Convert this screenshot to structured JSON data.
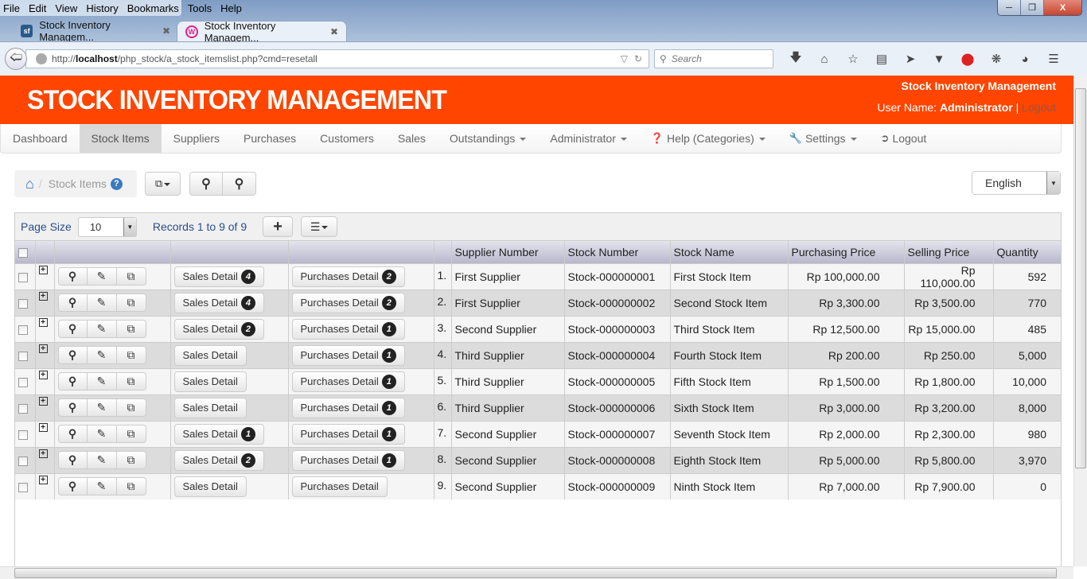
{
  "browser": {
    "menu": [
      "File",
      "Edit",
      "View",
      "History",
      "Bookmarks",
      "Tools",
      "Help"
    ],
    "tabs": [
      {
        "title": "Stock Inventory Managem...",
        "favicon": "sf",
        "active": false
      },
      {
        "title": "Stock Inventory Managem...",
        "favicon": "W",
        "active": true
      }
    ],
    "url_prefix": "http://",
    "url_host": "localhost",
    "url_path": "/php_stock/a_stock_itemslist.php?cmd=resetall",
    "search_placeholder": "Search"
  },
  "header": {
    "logo": "STOCK INVENTORY MANAGEMENT",
    "app_name": "Stock Inventory Management",
    "user_label": "User Name:",
    "user_name": "Administrator",
    "separator": "|",
    "logout": "Logout",
    "accent": "#ff4500"
  },
  "nav": [
    {
      "label": "Dashboard",
      "active": false
    },
    {
      "label": "Stock Items",
      "active": true
    },
    {
      "label": "Suppliers"
    },
    {
      "label": "Purchases"
    },
    {
      "label": "Customers"
    },
    {
      "label": "Sales"
    },
    {
      "label": "Outstandings",
      "dropdown": true
    },
    {
      "label": "Administrator",
      "dropdown": true
    },
    {
      "label": "Help (Categories)",
      "dropdown": true,
      "icon": "question-circle-icon"
    },
    {
      "label": "Settings",
      "dropdown": true,
      "icon": "wrench-icon"
    },
    {
      "label": "Logout",
      "icon": "sign-out-icon"
    }
  ],
  "breadcrumb": {
    "current": "Stock Items",
    "sep": "/"
  },
  "language": {
    "selected": "English"
  },
  "pager": {
    "page_size_label": "Page Size",
    "page_size": "10",
    "records": "Records 1 to 9 of 9"
  },
  "table": {
    "columns": [
      "Supplier Number",
      "Stock Number",
      "Stock Name",
      "Purchasing Price",
      "Selling Price",
      "Quantity"
    ],
    "sales_label": "Sales Detail",
    "purchases_label": "Purchases Detail",
    "rows": [
      {
        "n": "1.",
        "supplier": "First Supplier",
        "stock_no": "Stock-000000001",
        "name": "First Stock Item",
        "buy": "Rp 100,000.00",
        "sell": "Rp 110,000.00",
        "qty": "592",
        "sales": "4",
        "purch": "2"
      },
      {
        "n": "2.",
        "supplier": "First Supplier",
        "stock_no": "Stock-000000002",
        "name": "Second Stock Item",
        "buy": "Rp 3,300.00",
        "sell": "Rp 3,500.00",
        "qty": "770",
        "sales": "4",
        "purch": "2"
      },
      {
        "n": "3.",
        "supplier": "Second Supplier",
        "stock_no": "Stock-000000003",
        "name": "Third Stock Item",
        "buy": "Rp 12,500.00",
        "sell": "Rp 15,000.00",
        "qty": "485",
        "sales": "2",
        "purch": "1"
      },
      {
        "n": "4.",
        "supplier": "Third Supplier",
        "stock_no": "Stock-000000004",
        "name": "Fourth Stock Item",
        "buy": "Rp 200.00",
        "sell": "Rp 250.00",
        "qty": "5,000",
        "sales": "",
        "purch": "1"
      },
      {
        "n": "5.",
        "supplier": "Third Supplier",
        "stock_no": "Stock-000000005",
        "name": "Fifth Stock Item",
        "buy": "Rp 1,500.00",
        "sell": "Rp 1,800.00",
        "qty": "10,000",
        "sales": "",
        "purch": "1"
      },
      {
        "n": "6.",
        "supplier": "Third Supplier",
        "stock_no": "Stock-000000006",
        "name": "Sixth Stock Item",
        "buy": "Rp 3,000.00",
        "sell": "Rp 3,200.00",
        "qty": "8,000",
        "sales": "",
        "purch": "1"
      },
      {
        "n": "7.",
        "supplier": "Second Supplier",
        "stock_no": "Stock-000000007",
        "name": "Seventh Stock Item",
        "buy": "Rp 2,000.00",
        "sell": "Rp 2,300.00",
        "qty": "980",
        "sales": "1",
        "purch": "1"
      },
      {
        "n": "8.",
        "supplier": "Second Supplier",
        "stock_no": "Stock-000000008",
        "name": "Eighth Stock Item",
        "buy": "Rp 5,000.00",
        "sell": "Rp 5,800.00",
        "qty": "3,970",
        "sales": "2",
        "purch": "1"
      },
      {
        "n": "9.",
        "supplier": "Second Supplier",
        "stock_no": "Stock-000000009",
        "name": "Ninth Stock Item",
        "buy": "Rp 7,000.00",
        "sell": "Rp 7,900.00",
        "qty": "0",
        "sales": "",
        "purch": ""
      }
    ]
  }
}
